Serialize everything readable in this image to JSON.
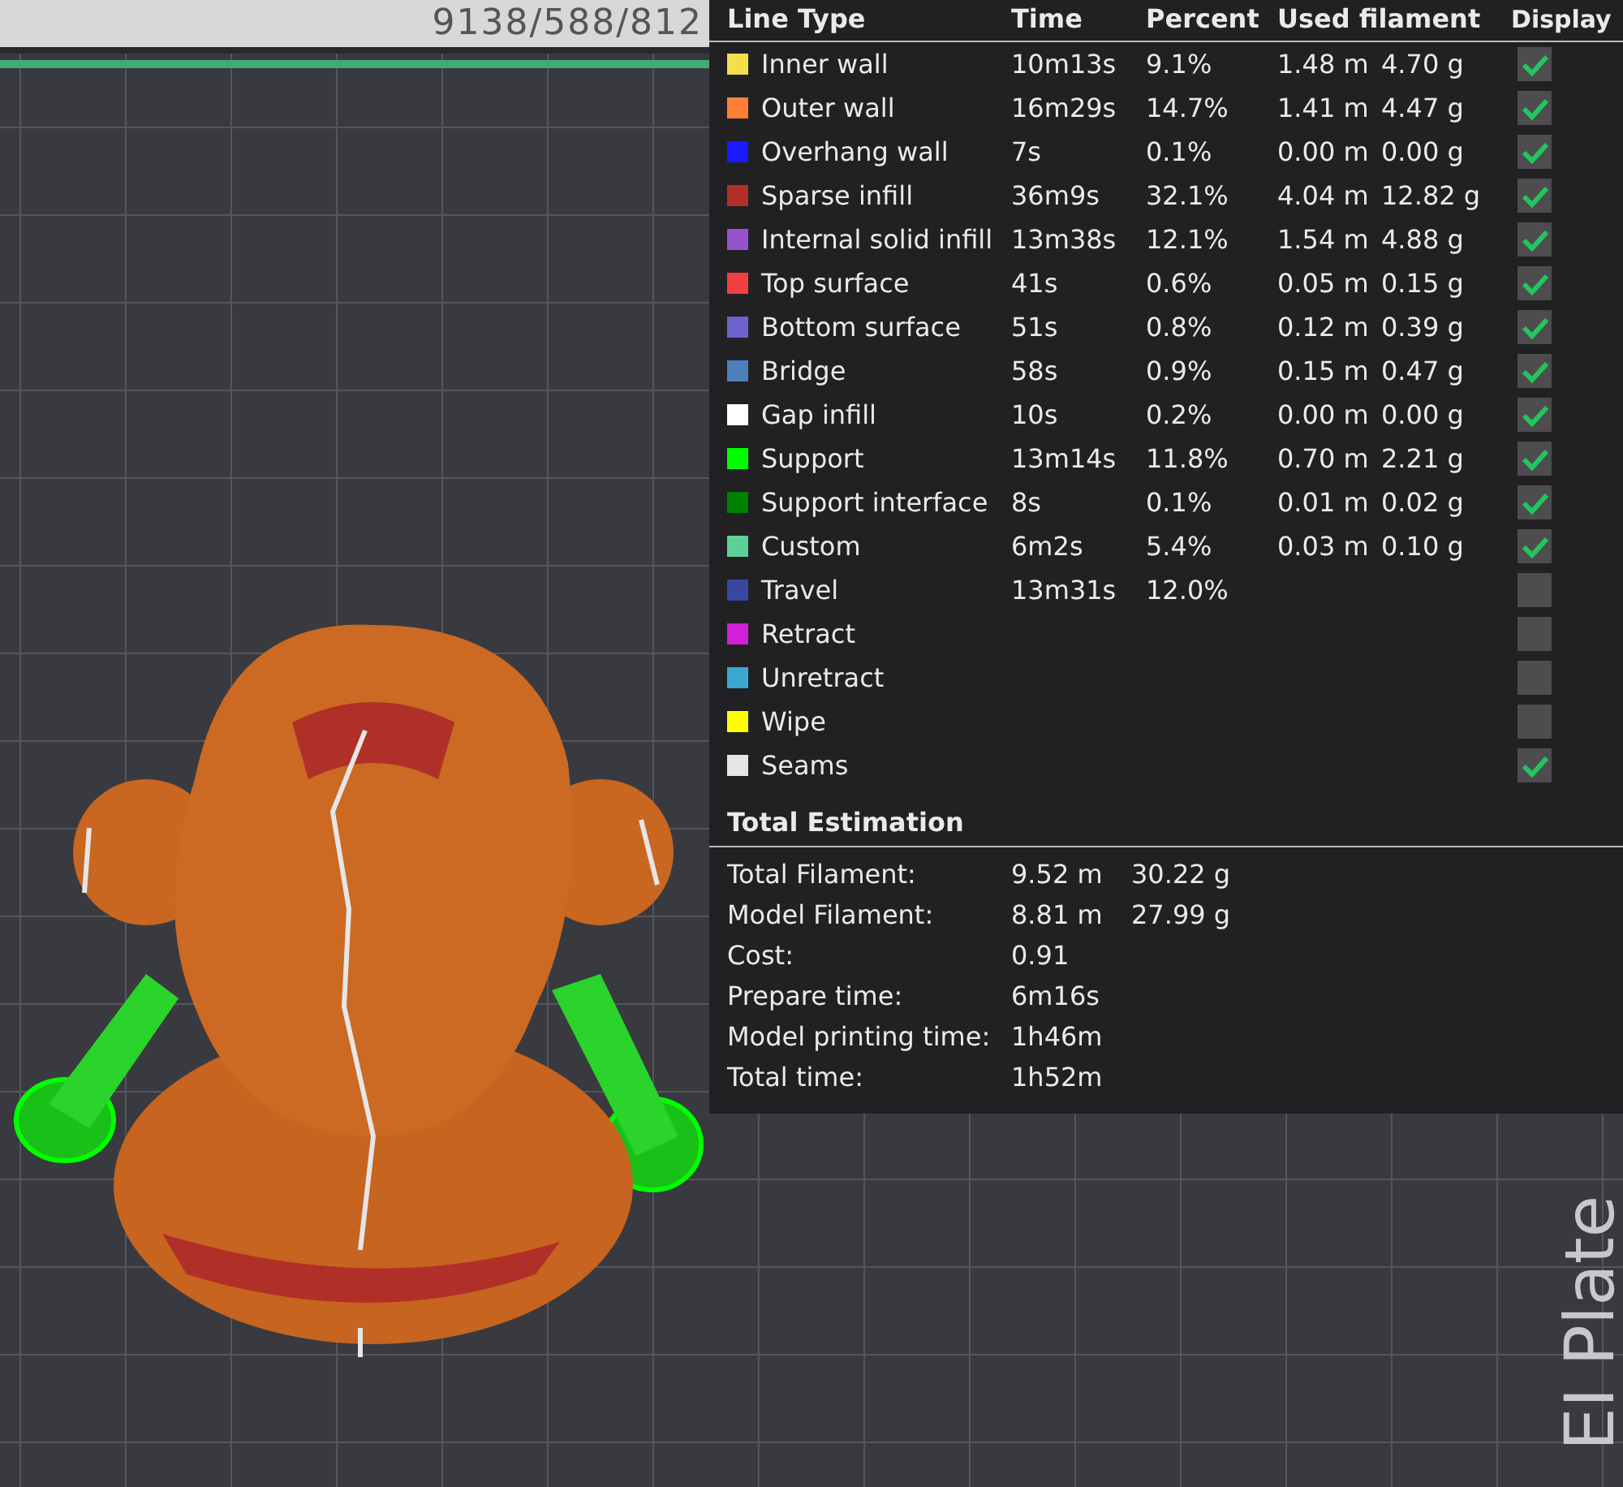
{
  "scene": {
    "top_label": "9138/588/812",
    "plate_label": "EI Plate"
  },
  "legend": {
    "columns": [
      "Line Type",
      "Time",
      "Percent",
      "Used filament",
      "Display"
    ],
    "rows": [
      {
        "name": "Inner wall",
        "color": "#f5de4b",
        "time": "10m13s",
        "percent": "9.1%",
        "length": "1.48 m",
        "weight": "4.70 g",
        "checked": true
      },
      {
        "name": "Outer wall",
        "color": "#ff7f36",
        "time": "16m29s",
        "percent": "14.7%",
        "length": "1.41 m",
        "weight": "4.47 g",
        "checked": true
      },
      {
        "name": "Overhang wall",
        "color": "#1a1aff",
        "time": "7s",
        "percent": "0.1%",
        "length": "0.00 m",
        "weight": "0.00 g",
        "checked": true
      },
      {
        "name": "Sparse infill",
        "color": "#b03029",
        "time": "36m9s",
        "percent": "32.1%",
        "length": "4.04 m",
        "weight": "12.82 g",
        "checked": true
      },
      {
        "name": "Internal solid infill",
        "color": "#9654cc",
        "time": "13m38s",
        "percent": "12.1%",
        "length": "1.54 m",
        "weight": "4.88 g",
        "checked": true
      },
      {
        "name": "Top surface",
        "color": "#f04040",
        "time": "41s",
        "percent": "0.6%",
        "length": "0.05 m",
        "weight": "0.15 g",
        "checked": true
      },
      {
        "name": "Bottom surface",
        "color": "#6b62cc",
        "time": "51s",
        "percent": "0.8%",
        "length": "0.12 m",
        "weight": "0.39 g",
        "checked": true
      },
      {
        "name": "Bridge",
        "color": "#4d80ba",
        "time": "58s",
        "percent": "0.9%",
        "length": "0.15 m",
        "weight": "0.47 g",
        "checked": true
      },
      {
        "name": "Gap infill",
        "color": "#ffffff",
        "time": "10s",
        "percent": "0.2%",
        "length": "0.00 m",
        "weight": "0.00 g",
        "checked": true
      },
      {
        "name": "Support",
        "color": "#00ff00",
        "time": "13m14s",
        "percent": "11.8%",
        "length": "0.70 m",
        "weight": "2.21 g",
        "checked": true
      },
      {
        "name": "Support interface",
        "color": "#008000",
        "time": "8s",
        "percent": "0.1%",
        "length": "0.01 m",
        "weight": "0.02 g",
        "checked": true
      },
      {
        "name": "Custom",
        "color": "#5ecf96",
        "time": "6m2s",
        "percent": "5.4%",
        "length": "0.03 m",
        "weight": "0.10 g",
        "checked": true
      },
      {
        "name": "Travel",
        "color": "#3848a0",
        "time": "13m31s",
        "percent": "12.0%",
        "checked": false
      },
      {
        "name": "Retract",
        "color": "#d020d8",
        "checked": false
      },
      {
        "name": "Unretract",
        "color": "#3aa8d0",
        "checked": false
      },
      {
        "name": "Wipe",
        "color": "#ffff00",
        "checked": false
      },
      {
        "name": "Seams",
        "color": "#e6e6e6",
        "checked": true
      }
    ]
  },
  "total_estimation": {
    "title": "Total Estimation",
    "rows": [
      {
        "label": "Total Filament:",
        "values": [
          "9.52 m",
          "30.22 g"
        ]
      },
      {
        "label": "Model Filament:",
        "values": [
          "8.81 m",
          "27.99 g"
        ]
      },
      {
        "label": "Cost:",
        "values": [
          "0.91"
        ]
      },
      {
        "label": "Prepare time:",
        "values": [
          "6m16s"
        ]
      },
      {
        "label": "Model printing time:",
        "values": [
          "1h46m"
        ]
      },
      {
        "label": "Total time:",
        "values": [
          "1h52m"
        ]
      }
    ]
  }
}
